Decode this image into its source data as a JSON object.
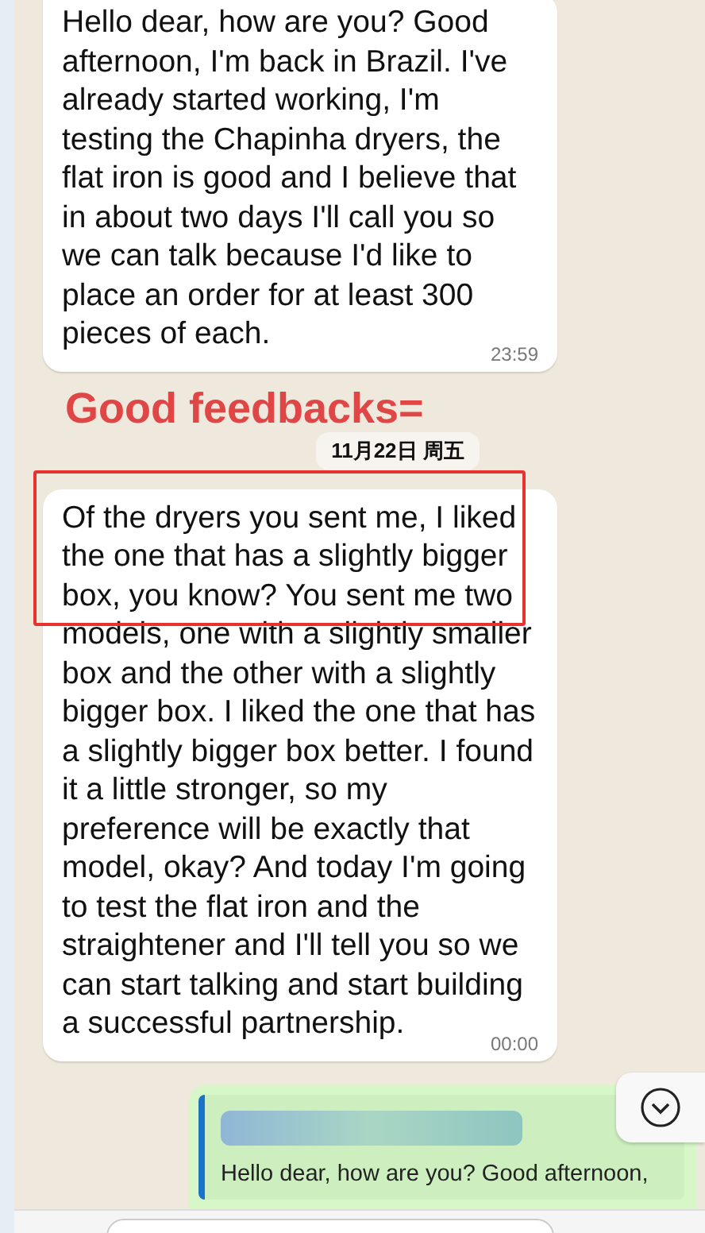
{
  "messages": [
    {
      "text": "Hello dear, how are you? Good afternoon, I'm back in Brazil. I've already started working, I'm testing the Chapinha dryers, the flat iron is good and I believe that in about two days I'll call you so we can talk because I'd like to place an order for at least 300 pieces of each.",
      "time": "23:59"
    }
  ],
  "annotation": "Good feedbacks=",
  "date_chip": "11月22日 周五",
  "messages_after": [
    {
      "text": "Of the dryers you sent me, I liked the one that has a slightly bigger box, you know? You sent me two models, one with a slightly smaller box and the other with a slightly bigger box. I liked the one that has a slightly bigger box better. I found it a little stronger, so my preference will be exactly that model, okay? And today I'm going to test the flat iron and the straightener and I'll tell you so we can start talking and start building a successful partnership.",
      "time": "00:00",
      "highlighted": true
    }
  ],
  "reply": {
    "quote": "Hello dear, how are you? Good afternoon,"
  }
}
